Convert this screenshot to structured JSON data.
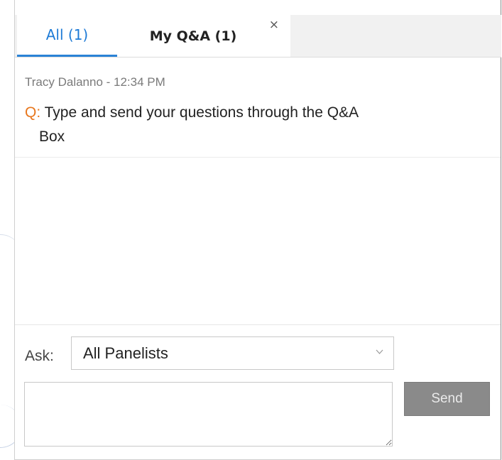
{
  "tabs": {
    "all_label": "All (1)",
    "my_label": "My Q&A (1)",
    "close_glyph": "×"
  },
  "question": {
    "author_time": "Tracy Dalanno - 12:34 PM",
    "prefix": "Q:",
    "text_line1": "Type and send your questions through the Q&A",
    "text_line2": "Box"
  },
  "ask": {
    "label": "Ask:",
    "selected": "All Panelists"
  },
  "composer": {
    "value": "",
    "send_label": "Send"
  },
  "colors": {
    "tab_active": "#1e7bd6",
    "question_prefix": "#e8771e",
    "send_button": "#8a8a8a"
  }
}
